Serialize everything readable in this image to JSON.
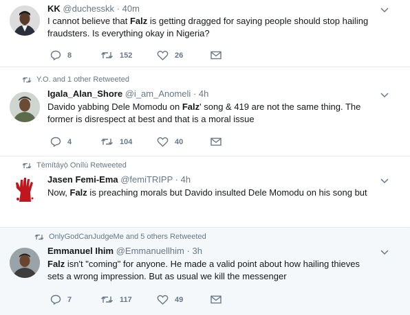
{
  "tweets": [
    {
      "retweeted_by": "",
      "name": "KK",
      "handle": "@duchesskk",
      "time": "40m",
      "text_parts": [
        "I cannot believe that ",
        "Falz",
        " is getting dragged for saying people should stop hailing fraudsters. Is everything okay in Nigeria?"
      ],
      "replies": "8",
      "retweets": "152",
      "likes": "26"
    },
    {
      "retweeted_by": "Y.O. and 1 other Retweeted",
      "name": "Igala_Alan_Shore",
      "handle": "@i_am_Anomeli",
      "time": "4h",
      "text_parts": [
        "Davido yabbing Dele Momodu on ",
        "Falz",
        "' song & 419 are not the same thing. The former is disrespect at best and that is a moral issue"
      ],
      "replies": "4",
      "retweets": "104",
      "likes": "40"
    },
    {
      "retweeted_by": "Tèmítáyọ̀ Onílù Retweeted",
      "name": "Jasen Femi-Ema",
      "handle": "@femiTRIPP",
      "time": "4h",
      "text_parts": [
        "Now, ",
        "Falz",
        " is preaching morals but Davido insulted Dele Momodu on his song but"
      ],
      "replies": "",
      "retweets": "",
      "likes": ""
    },
    {
      "retweeted_by": "OnlyGodCanJudgeMe and 5 others Retweeted",
      "name": "Emmanuel Ihim",
      "handle": "@Emmanuellhim",
      "time": "3h",
      "text_parts": [
        "",
        "Falz",
        " isn't \"coming\" for anyone. He made a valid point about how hailing thieves sets a wrong impression. But as usual we kill the messenger"
      ],
      "replies": "7",
      "retweets": "117",
      "likes": "49"
    }
  ],
  "dot": "·",
  "colors": {
    "text": "#14171a",
    "muted": "#657786",
    "border": "#e6ecf0",
    "highlight_bg": "#f5f8fa"
  }
}
